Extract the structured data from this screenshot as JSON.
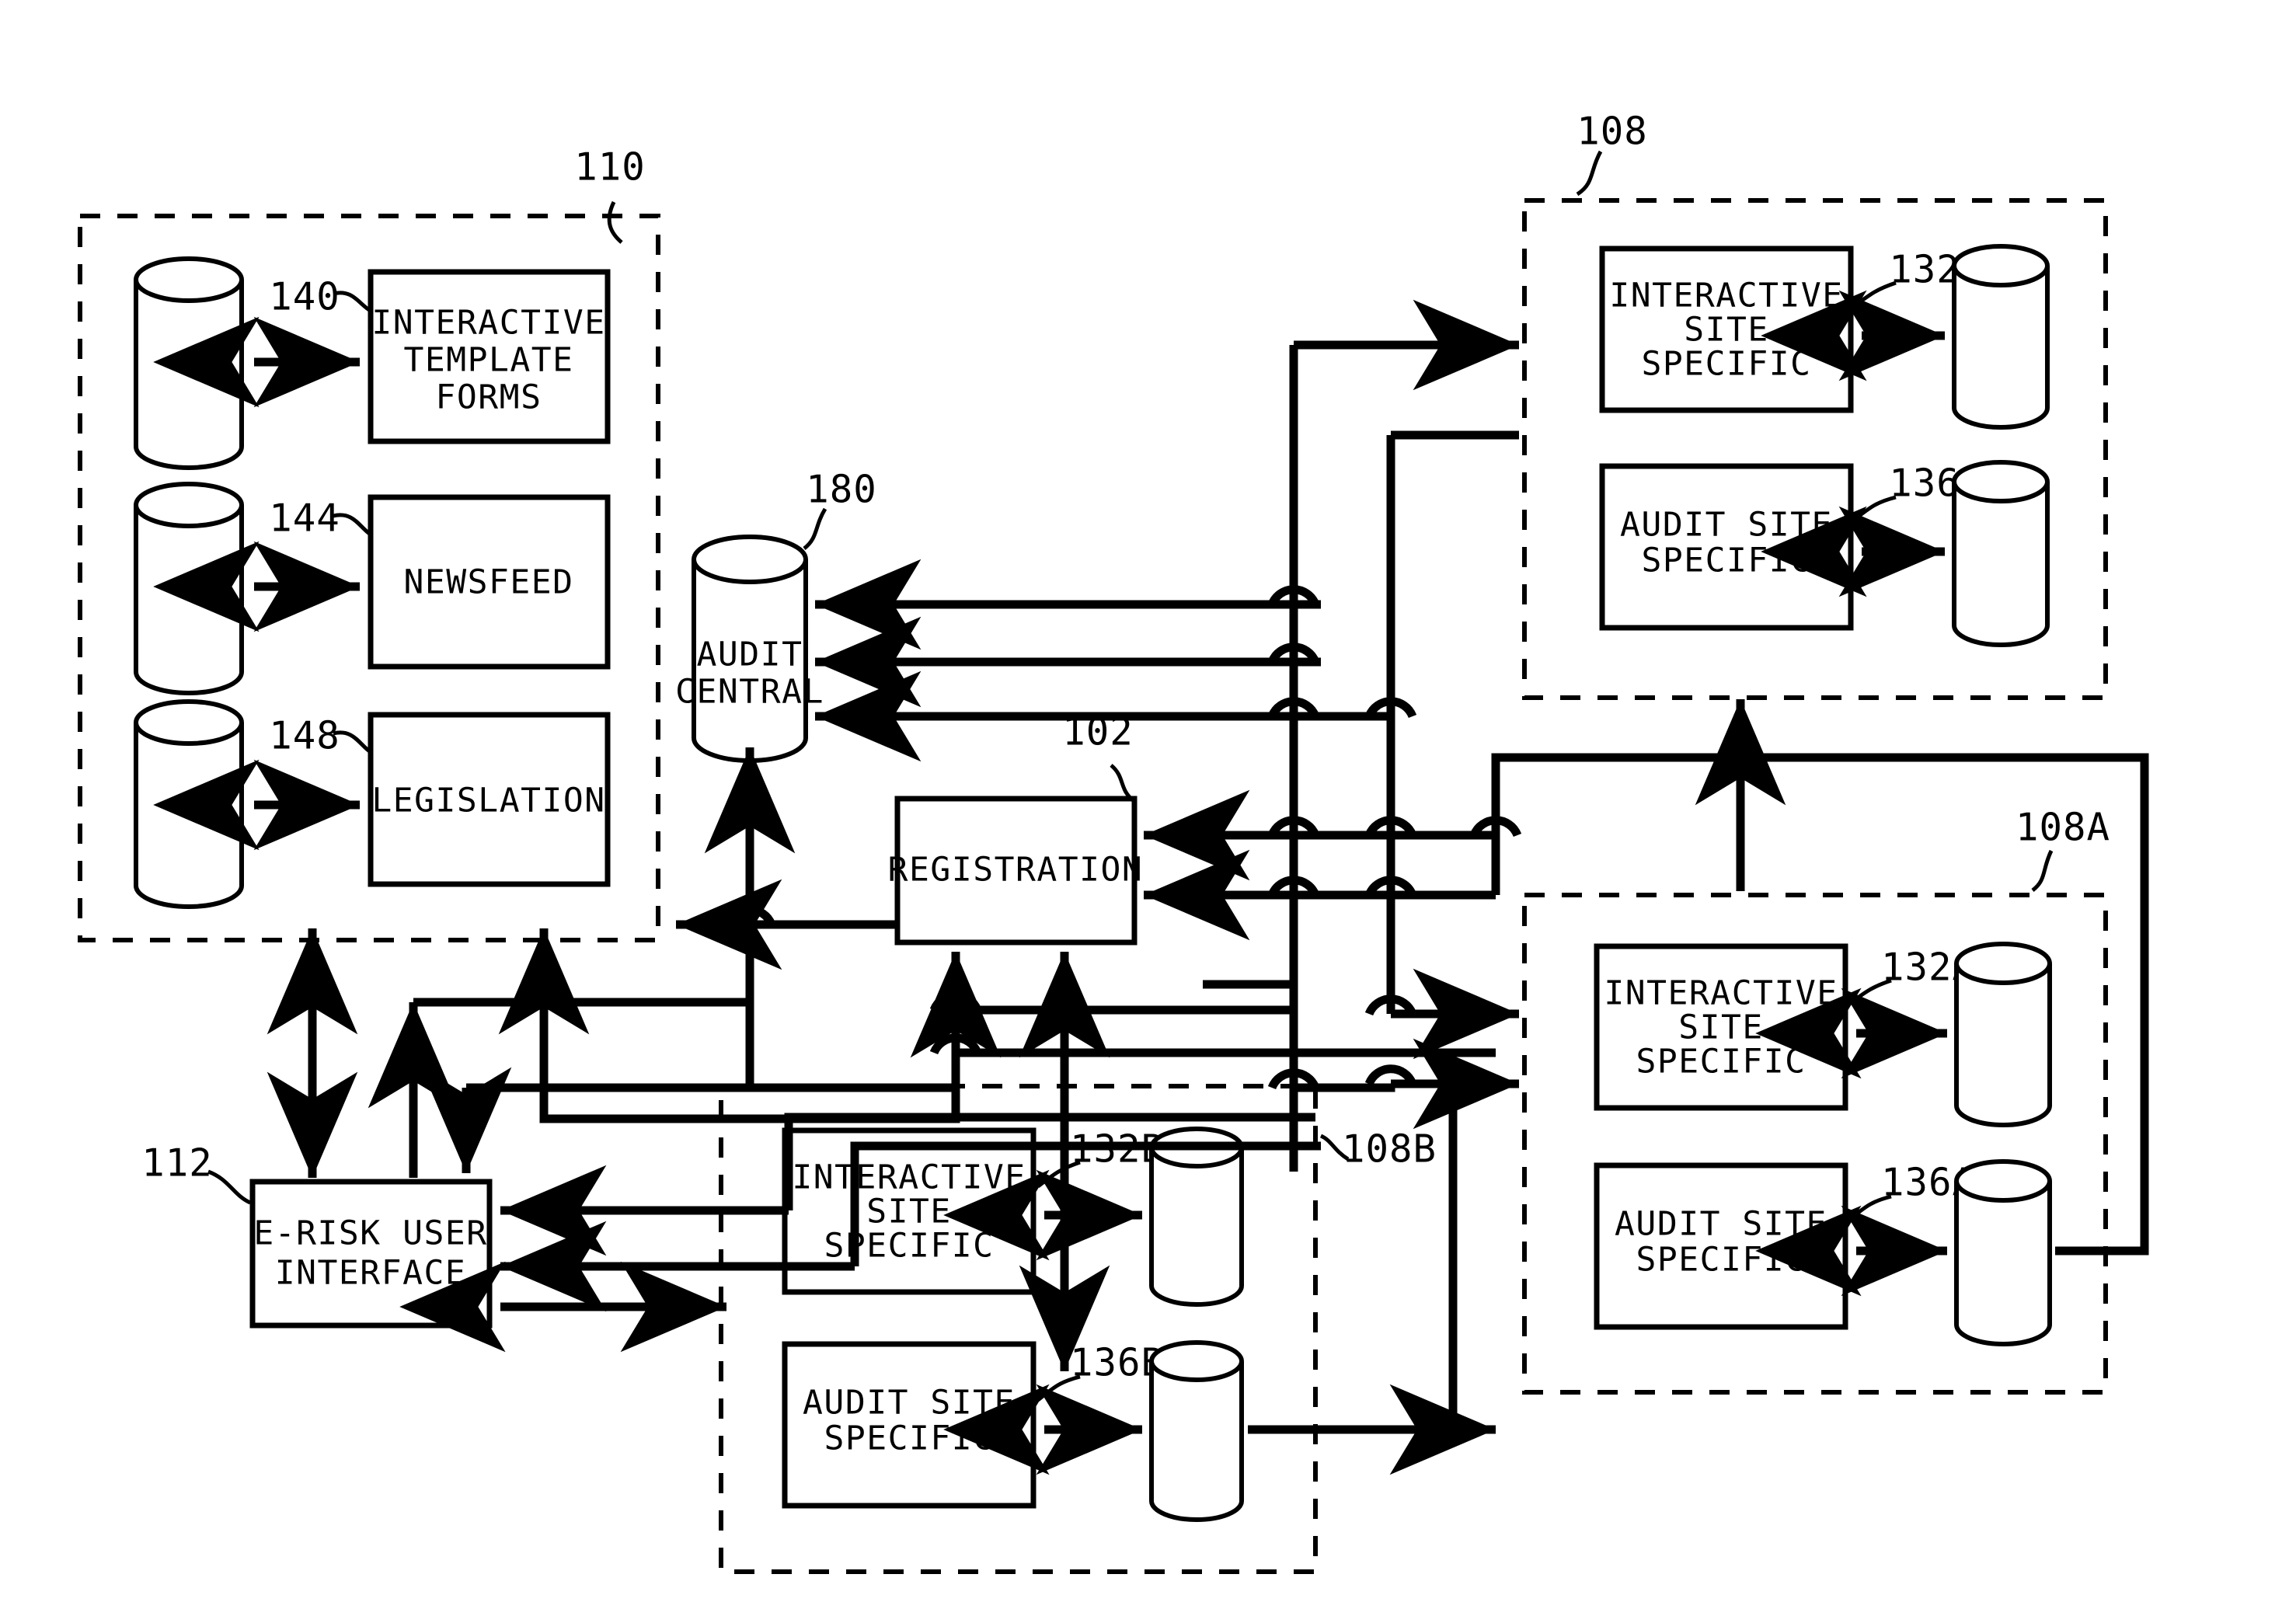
{
  "figure": {
    "kind": "patent-block-diagram",
    "background": "#ffffff",
    "ink": "#000000"
  },
  "groups": {
    "g110": {
      "ref": "110"
    },
    "g108": {
      "ref": "108"
    },
    "g108a": {
      "ref": "108A"
    },
    "g108b": {
      "ref": "108B"
    }
  },
  "boxes": {
    "interactive_template_forms": {
      "ref": "140",
      "line1": "INTERACTIVE",
      "line2": "TEMPLATE",
      "line3": "FORMS"
    },
    "newsfeed": {
      "ref": "144",
      "line1": "NEWSFEED"
    },
    "legislation": {
      "ref": "148",
      "line1": "LEGISLATION"
    },
    "audit_central": {
      "ref": "180",
      "line1": "AUDIT",
      "line2": "CENTRAL"
    },
    "registration": {
      "ref": "102",
      "line1": "REGISTRATION"
    },
    "erisk_user_interface": {
      "ref": "112",
      "line1": "E-RISK USER",
      "line2": "INTERFACE"
    },
    "interactive_site_specific_108": {
      "ref": "132",
      "line1": "INTERACTIVE",
      "line2": "SITE",
      "line3": "SPECIFIC"
    },
    "audit_site_specific_108": {
      "ref": "136",
      "line1": "AUDIT SITE",
      "line2": "SPECIFIC"
    },
    "interactive_site_specific_108a": {
      "ref": "132A",
      "line1": "INTERACTIVE",
      "line2": "SITE",
      "line3": "SPECIFIC"
    },
    "audit_site_specific_108a": {
      "ref": "136A",
      "line1": "AUDIT SITE",
      "line2": "SPECIFIC"
    },
    "interactive_site_specific_108b": {
      "ref": "132B",
      "line1": "INTERACTIVE",
      "line2": "SITE",
      "line3": "SPECIFIC"
    },
    "audit_site_specific_108b": {
      "ref": "136B",
      "line1": "AUDIT SITE",
      "line2": "SPECIFIC"
    }
  }
}
